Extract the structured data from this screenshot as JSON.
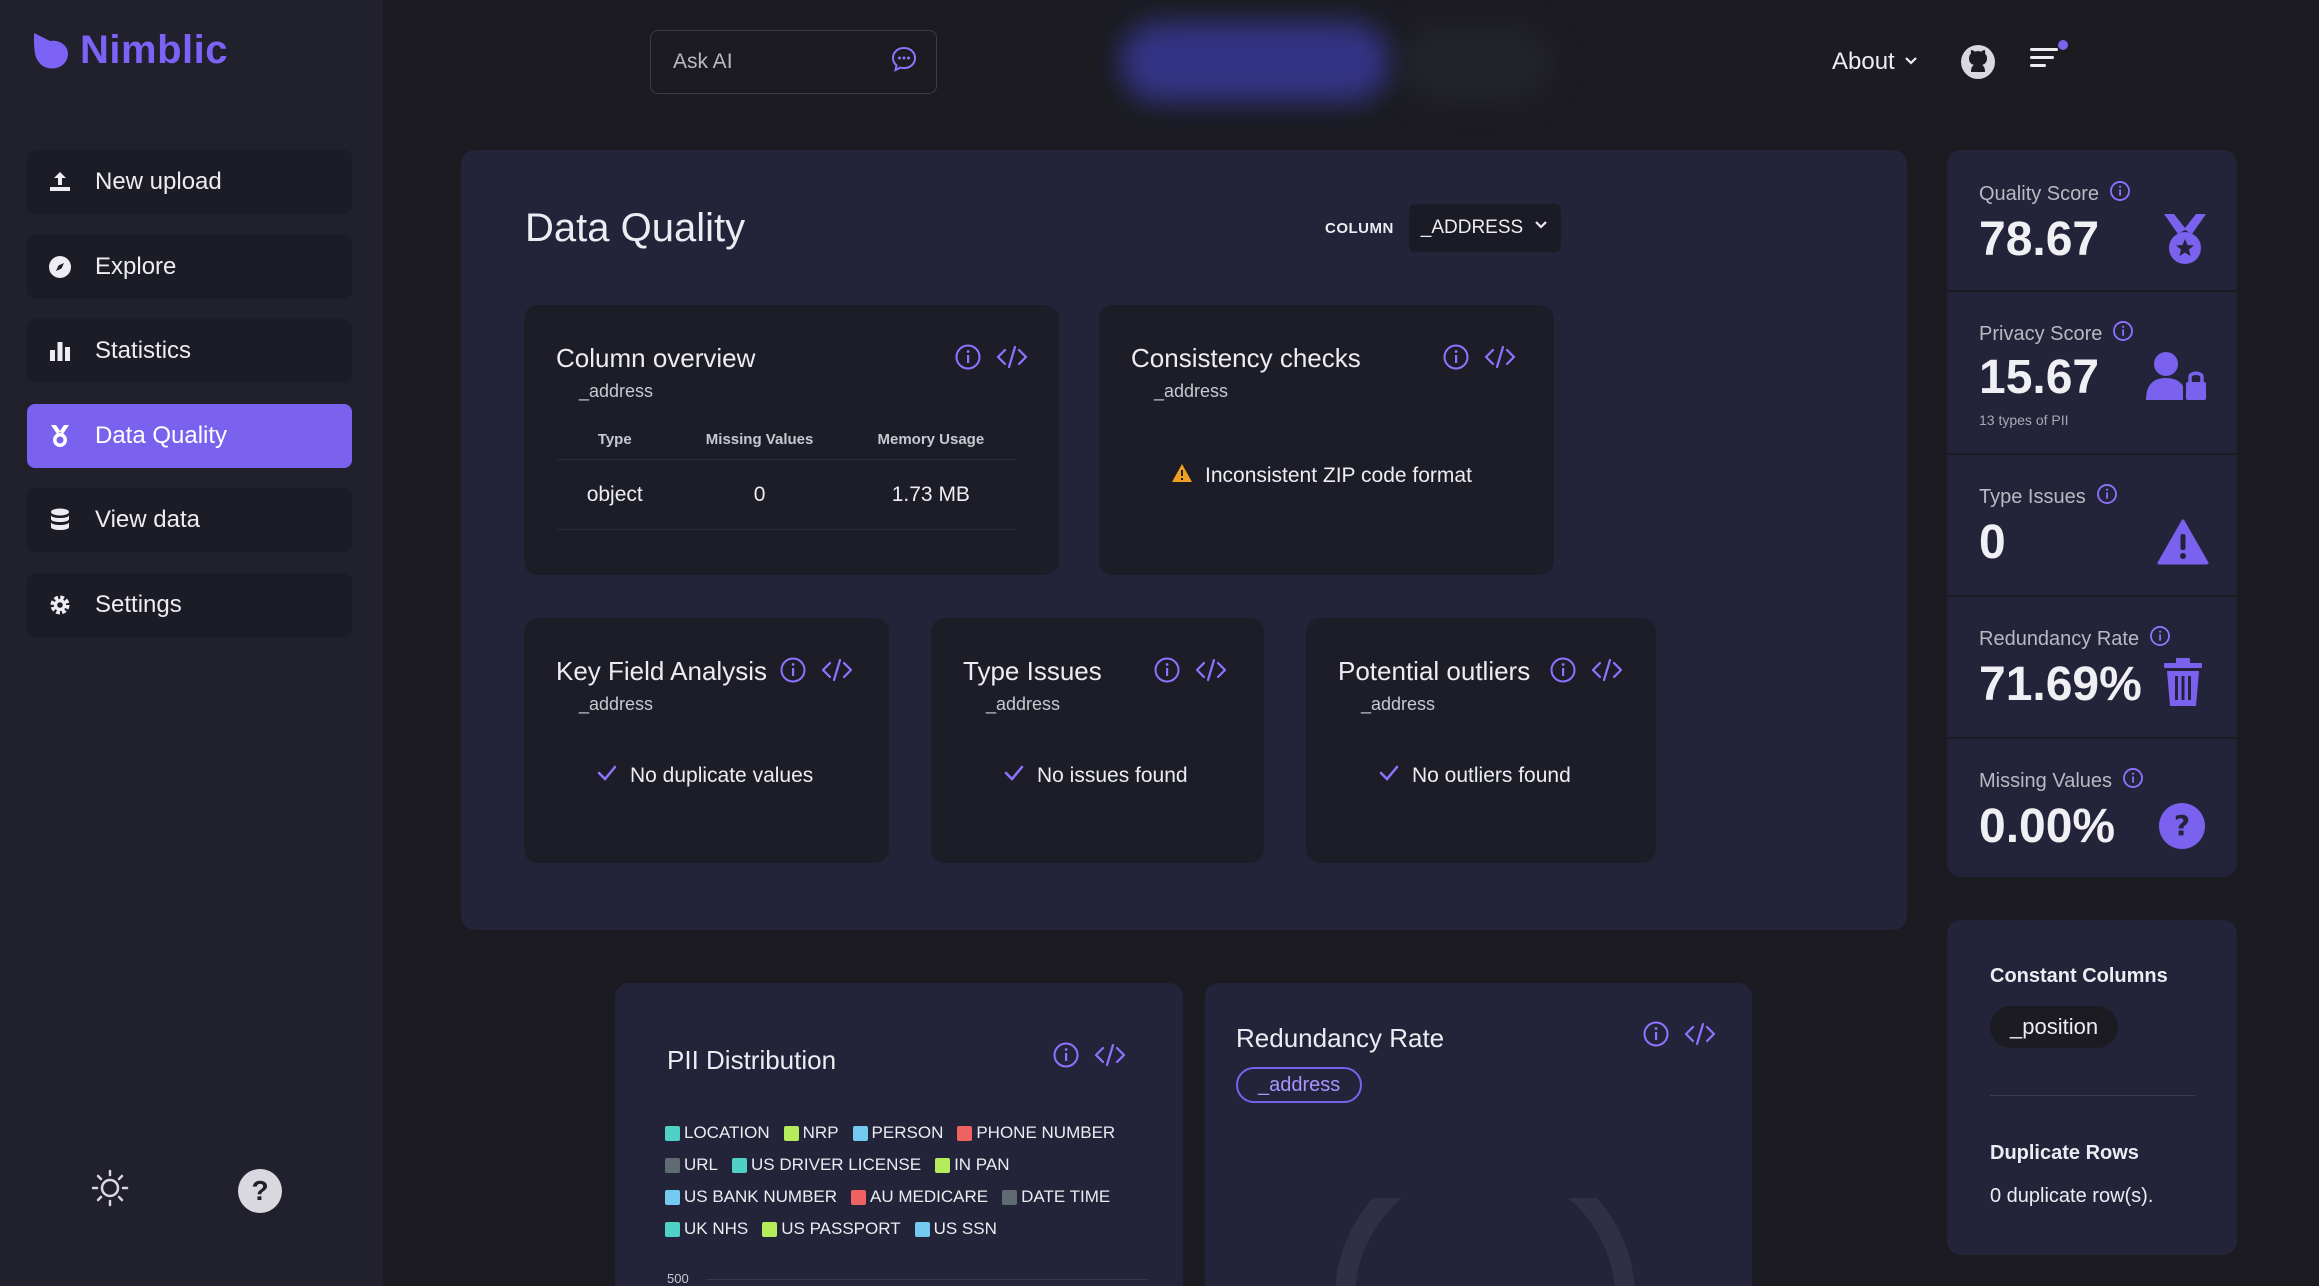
{
  "app": {
    "name": "Nimblic"
  },
  "sidebar": {
    "items": [
      {
        "label": "New upload",
        "icon": "upload-icon"
      },
      {
        "label": "Explore",
        "icon": "compass-icon"
      },
      {
        "label": "Statistics",
        "icon": "bar-chart-icon"
      },
      {
        "label": "Data Quality",
        "icon": "medal-icon",
        "active": true
      },
      {
        "label": "View data",
        "icon": "database-icon"
      },
      {
        "label": "Settings",
        "icon": "gear-icon"
      }
    ]
  },
  "topbar": {
    "ask_ai_placeholder": "Ask AI",
    "about_label": "About"
  },
  "main": {
    "title": "Data Quality",
    "column_label": "COLUMN",
    "column_value": "_ADDRESS",
    "column_overview": {
      "title": "Column overview",
      "sub": "_address",
      "headers": [
        "Type",
        "Missing Values",
        "Memory Usage"
      ],
      "row": [
        "object",
        "0",
        "1.73 MB"
      ]
    },
    "consistency": {
      "title": "Consistency checks",
      "sub": "_address",
      "message": "Inconsistent ZIP code format"
    },
    "key_field": {
      "title": "Key Field Analysis",
      "sub": "_address",
      "message": "No duplicate values"
    },
    "type_issues": {
      "title": "Type Issues",
      "sub": "_address",
      "message": "No issues found"
    },
    "outliers": {
      "title": "Potential outliers",
      "sub": "_address",
      "message": "No outliers found"
    }
  },
  "metrics": [
    {
      "label": "Quality Score",
      "value": "78.67",
      "sub": "",
      "icon": "medal-icon"
    },
    {
      "label": "Privacy Score",
      "value": "15.67",
      "sub": "13 types of PII",
      "icon": "user-lock-icon"
    },
    {
      "label": "Type Issues",
      "value": "0",
      "sub": "",
      "icon": "warning-triangle-icon"
    },
    {
      "label": "Redundancy Rate",
      "value": "71.69%",
      "sub": "",
      "icon": "trash-icon"
    },
    {
      "label": "Missing Values",
      "value": "0.00%",
      "sub": "",
      "icon": "question-circle-icon"
    }
  ],
  "constant_columns": {
    "title": "Constant Columns",
    "items": [
      "_position"
    ],
    "duplicate_title": "Duplicate Rows",
    "duplicate_text": "0 duplicate row(s)."
  },
  "pii": {
    "title": "PII Distribution",
    "legend": [
      {
        "label": "LOCATION",
        "color": "#4fd1c5"
      },
      {
        "label": "NRP",
        "color": "#b5ec5c"
      },
      {
        "label": "PERSON",
        "color": "#74c9f0"
      },
      {
        "label": "PHONE NUMBER",
        "color": "#f06262"
      },
      {
        "label": "URL",
        "color": "#5e6b73"
      },
      {
        "label": "US DRIVER LICENSE",
        "color": "#4fd1c5"
      },
      {
        "label": "IN PAN",
        "color": "#b5ec5c"
      },
      {
        "label": "US BANK NUMBER",
        "color": "#74c9f0"
      },
      {
        "label": "AU MEDICARE",
        "color": "#f06262"
      },
      {
        "label": "DATE TIME",
        "color": "#5e6b73"
      },
      {
        "label": "UK NHS",
        "color": "#4fd1c5"
      },
      {
        "label": "US PASSPORT",
        "color": "#b5ec5c"
      },
      {
        "label": "US SSN",
        "color": "#74c9f0"
      }
    ],
    "y_tick_top": "500"
  },
  "redundancy_card": {
    "title": "Redundancy Rate",
    "column_pill": "_address"
  },
  "colors": {
    "accent": "#7a62ee",
    "warning": "#f0a020"
  }
}
